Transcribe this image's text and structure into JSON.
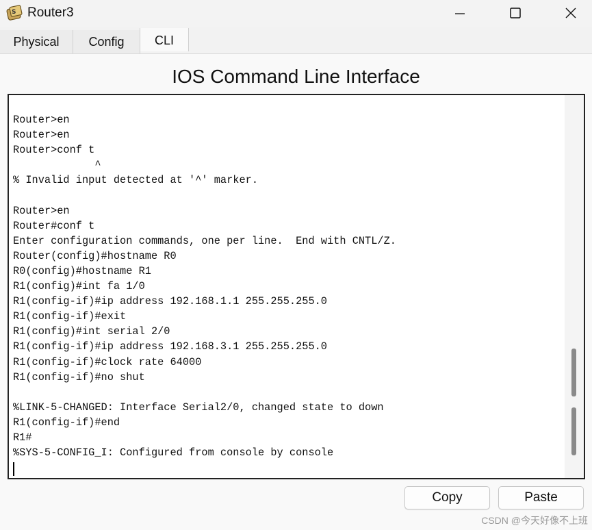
{
  "window": {
    "title": "Router3",
    "controls": {
      "minimize": "minimize-icon",
      "maximize": "maximize-icon",
      "close": "close-icon"
    }
  },
  "tabs": [
    {
      "label": "Physical",
      "active": false
    },
    {
      "label": "Config",
      "active": false
    },
    {
      "label": "CLI",
      "active": true
    }
  ],
  "cli": {
    "heading": "IOS Command Line Interface",
    "lines": [
      "Router>en",
      "Router>en",
      "Router>conf t",
      "             ^",
      "% Invalid input detected at '^' marker.",
      "",
      "Router>en",
      "Router#conf t",
      "Enter configuration commands, one per line.  End with CNTL/Z.",
      "Router(config)#hostname R0",
      "R0(config)#hostname R1",
      "R1(config)#int fa 1/0",
      "R1(config-if)#ip address 192.168.1.1 255.255.255.0",
      "R1(config-if)#exit",
      "R1(config)#int serial 2/0",
      "R1(config-if)#ip address 192.168.3.1 255.255.255.0",
      "R1(config-if)#clock rate 64000",
      "R1(config-if)#no shut",
      "",
      "%LINK-5-CHANGED: Interface Serial2/0, changed state to down",
      "R1(config-if)#end",
      "R1#",
      "%SYS-5-CONFIG_I: Configured from console by console"
    ]
  },
  "buttons": {
    "copy": "Copy",
    "paste": "Paste"
  },
  "watermark": "CSDN @今天好像不上班",
  "colors": {
    "terminal_bg": "#ffffff",
    "terminal_border": "#222222",
    "scroll_thumb": "#8a8a8a"
  }
}
